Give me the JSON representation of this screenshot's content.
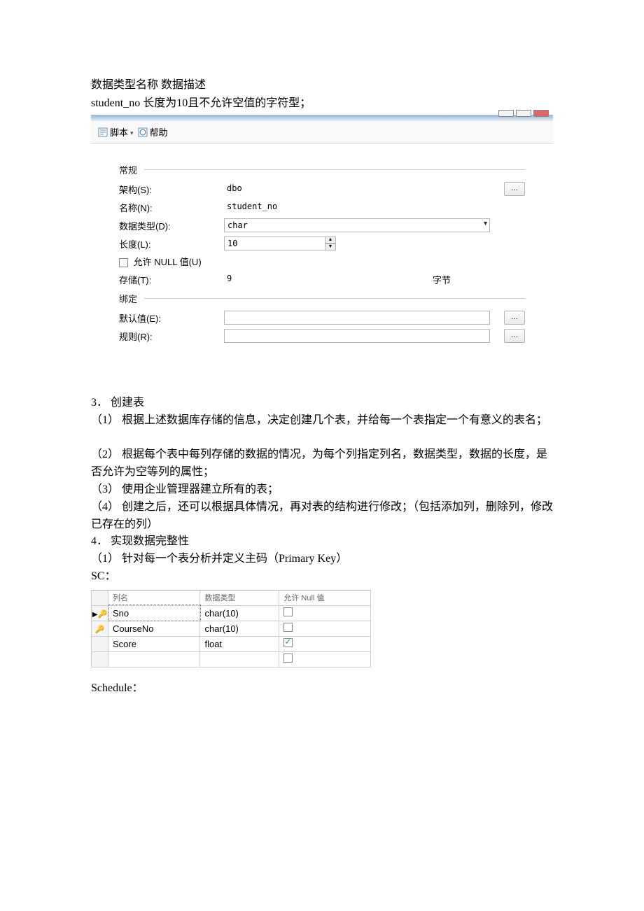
{
  "intro": {
    "line1": "数据类型名称  数据描述",
    "line2": "student_no  长度为10且不允许空值的字符型；"
  },
  "toolbar": {
    "script": "脚本",
    "help": "帮助"
  },
  "general": {
    "header": "常规",
    "schema_label": "架构(S):",
    "schema_value": "dbo",
    "name_label": "名称(N):",
    "name_value": "student_no",
    "dtype_label": "数据类型(D):",
    "dtype_value": "char",
    "length_label": "长度(L):",
    "length_value": "10",
    "allow_null_label": "允许 NULL 值(U)",
    "storage_label": "存储(T):",
    "storage_value": "9",
    "storage_unit": "字节"
  },
  "binding": {
    "header": "绑定",
    "default_label": "默认值(E):",
    "default_value": "",
    "rule_label": "规则(R):",
    "rule_value": ""
  },
  "body": {
    "p1": "3．  创建表",
    "p2": "（1） 根据上述数据库存储的信息，决定创建几个表，并给每一个表指定一个有意义的表名；",
    "p3": "（2） 根据每个表中每列存储的数据的情况，为每个列指定列名，数据类型，数据的长度，是否允许为空等列的属性；",
    "p4": "（3） 使用企业管理器建立所有的表；",
    "p5": "（4） 创建之后，还可以根据具体情况，再对表的结构进行修改；（包括添加列，删除列，修改已存在的列）",
    "p6": "4．  实现数据完整性",
    "p7": "（1） 针对每一个表分析并定义主码（Primary Key）",
    "p8": "SC：",
    "p9": "Schedule："
  },
  "table": {
    "cols": {
      "c1": "列名",
      "c2": "数据类型",
      "c3": "允许 Null 值"
    },
    "rows": [
      {
        "key": true,
        "ptr": true,
        "name": "Sno",
        "type": "char(10)",
        "null": false
      },
      {
        "key": true,
        "ptr": false,
        "name": "CourseNo",
        "type": "char(10)",
        "null": false
      },
      {
        "key": false,
        "ptr": false,
        "name": "Score",
        "type": "float",
        "null": true
      },
      {
        "key": false,
        "ptr": false,
        "name": "",
        "type": "",
        "null": false
      }
    ]
  },
  "ellipsis": "…"
}
